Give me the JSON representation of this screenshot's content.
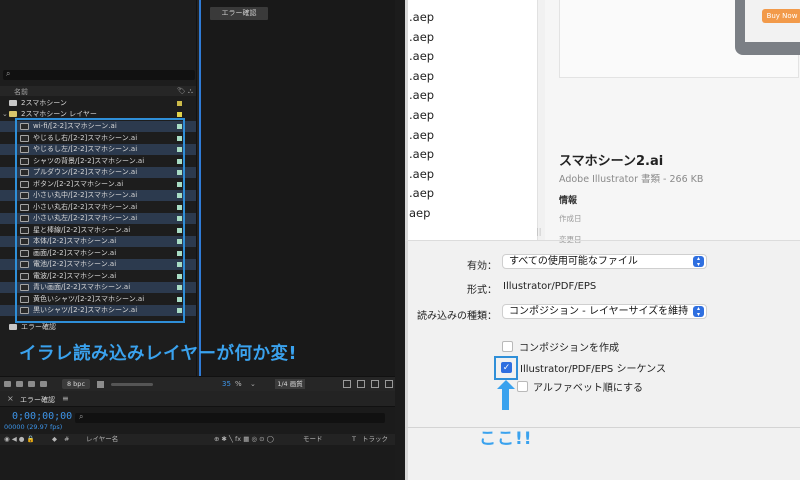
{
  "ae": {
    "top_button": "エラー確認",
    "project": {
      "col_name": "名前",
      "items": [
        {
          "label": "2スマホシーン",
          "type": "comp",
          "color": "#cdbb4a"
        },
        {
          "label": "2スマホシーン レイヤー",
          "type": "folder",
          "color": "#e2d34a"
        }
      ],
      "layers": [
        "wi-fi/[2-2]スマホシーン.ai",
        "やじるし右/[2-2]スマホシーン.ai",
        "やじるし左/[2-2]スマホシーン.ai",
        "シャツの背景/[2-2]スマホシーン.ai",
        "プルダウン/[2-2]スマホシーン.ai",
        "ボタン/[2-2]スマホシーン.ai",
        "小さい丸中/[2-2]スマホシーン.ai",
        "小さい丸右/[2-2]スマホシーン.ai",
        "小さい丸左/[2-2]スマホシーン.ai",
        "星と棒線/[2-2]スマホシーン.ai",
        "本体/[2-2]スマホシーン.ai",
        "画面/[2-2]スマホシーン.ai",
        "電池/[2-2]スマホシーン.ai",
        "電波/[2-2]スマホシーン.ai",
        "青い画面/[2-2]スマホシーン.ai",
        "黄色いシャツ/[2-2]スマホシーン.ai",
        "黒いシャツ/[2-2]スマホシーン.ai"
      ],
      "last_item": "エラー確認",
      "layer_swatch_color": "#a8dcc4"
    },
    "caption": "イラレ読み込みレイヤーが何か変!",
    "bottom": {
      "bpc": "8 bpc",
      "zoom": "35",
      "zoom_unit": "%",
      "quality": "1/4 画質"
    },
    "timeline": {
      "tab_label": "エラー確認",
      "timecode": "0;00;00;00",
      "fps": "00000 (29.97 fps)",
      "col_layer_name": "レイヤー名",
      "col_mode": "モード",
      "col_t": "T",
      "col_track": "トラック"
    }
  },
  "dialog": {
    "files": [
      ".aep",
      ".aep",
      ".aep",
      ".aep",
      ".aep",
      ".aep",
      ".aep",
      ".aep",
      ".aep",
      ".aep",
      "aep"
    ],
    "preview": {
      "buy_button": "Buy Now"
    },
    "file_name": "スマホシーン2.ai",
    "file_kind": "Adobe Illustrator 書類 - 266 KB",
    "info_heading": "情報",
    "created_label": "作成日",
    "modified_label": "変更日",
    "enable_label": "有効：",
    "enable_value": "すべての使用可能なファイル",
    "format_label": "形式：",
    "format_value": "Illustrator/PDF/EPS",
    "import_type_label": "読み込みの種類：",
    "import_type_value": "コンポジション - レイヤーサイズを維持",
    "options": [
      {
        "label": "コンポジションを作成",
        "checked": false
      },
      {
        "label": "Illustrator/PDF/EPS シーケンス",
        "checked": true
      },
      {
        "label": "アルファベット順にする",
        "checked": false
      }
    ],
    "annotation": "ここ!!"
  },
  "colors": {
    "highlight_blue": "#2f8fd8",
    "caption_blue": "#3aa2ee",
    "ae_bg": "#1d1d1d",
    "dialog_bg": "#f1f1f1",
    "select_accent": "#2f6fe0"
  }
}
